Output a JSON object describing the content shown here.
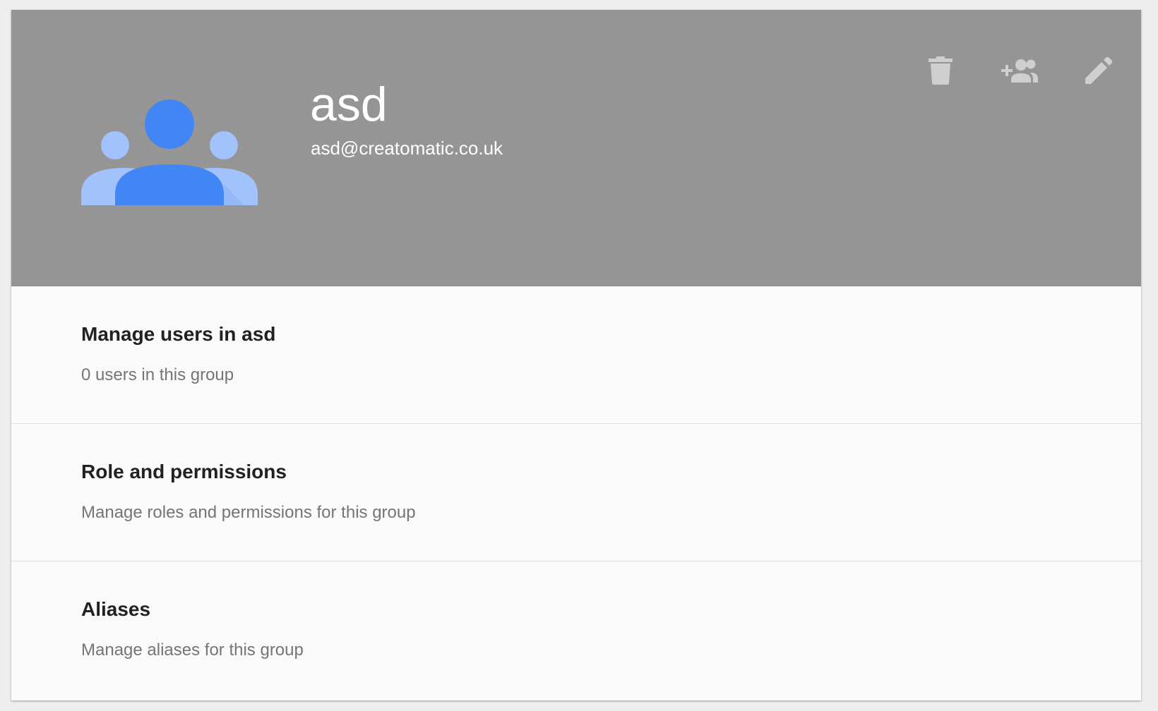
{
  "group": {
    "name": "asd",
    "email": "asd@creatomatic.co.uk"
  },
  "header_actions": [
    {
      "icon": "delete-icon"
    },
    {
      "icon": "add-member-icon"
    },
    {
      "icon": "edit-icon"
    }
  ],
  "sections": [
    {
      "title": "Manage users in asd",
      "description": "0 users in this group"
    },
    {
      "title": "Role and permissions",
      "description": "Manage roles and permissions for this group"
    },
    {
      "title": "Aliases",
      "description": "Manage aliases for this group"
    }
  ],
  "colors": {
    "header_bg": "#959595",
    "avatar_primary": "#4285f4",
    "avatar_secondary": "#a1c2fa",
    "icon": "#cfcfcf",
    "title_text": "#212121",
    "secondary_text": "#757575"
  }
}
